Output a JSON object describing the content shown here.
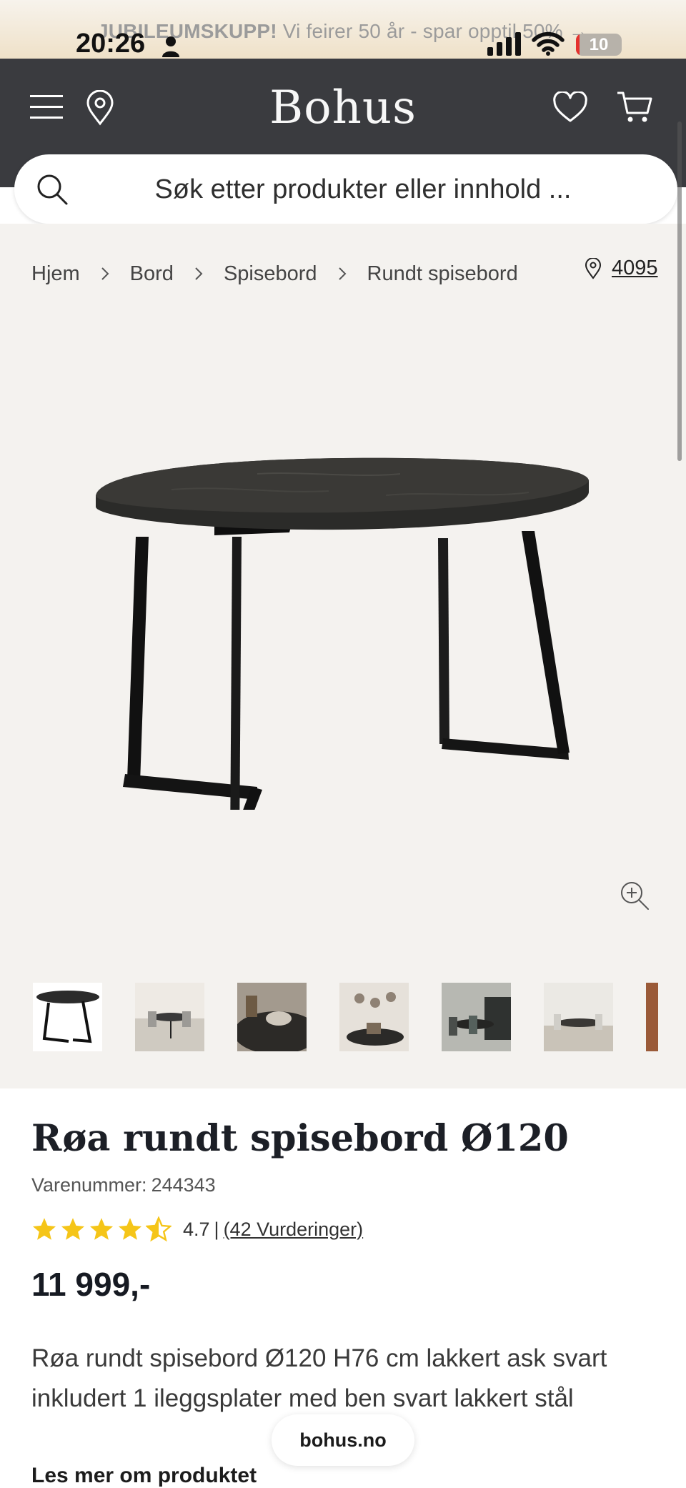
{
  "status_bar": {
    "time": "20:26",
    "battery": "10"
  },
  "promo": {
    "strong": "JUBILEUMSKUPP!",
    "text": "Vi feirer 50 år - spar opptil 50%",
    "arrow": "→"
  },
  "header": {
    "logo": "Bohus",
    "icons": [
      "menu-icon",
      "location-pin-icon",
      "heart-icon",
      "cart-icon"
    ]
  },
  "search": {
    "placeholder": "Søk etter produkter eller innhold ..."
  },
  "breadcrumb": [
    "Hjem",
    "Bord",
    "Spisebord",
    "Rundt spisebord"
  ],
  "store": {
    "label": "4095"
  },
  "gallery": {
    "thumbnail_count": 7,
    "selected_index": 0
  },
  "product": {
    "title": "Røa rundt spisebord Ø120",
    "sku_label": "Varenummer:",
    "sku": "244343",
    "rating": 4.7,
    "rating_label": "4.7",
    "reviews_label": "(42 Vurderinger)",
    "price": "11 999,-",
    "description": "Røa rundt spisebord Ø120 H76 cm lakkert ask svart inkludert 1 ileggsplater med ben svart lakkert stål",
    "read_more": "Les mer om produktet"
  },
  "browser": {
    "url": "bohus.no"
  },
  "colors": {
    "header_bg": "#3a3b3f",
    "star": "#f5c518",
    "gallery_bg": "#f4f2ef"
  }
}
